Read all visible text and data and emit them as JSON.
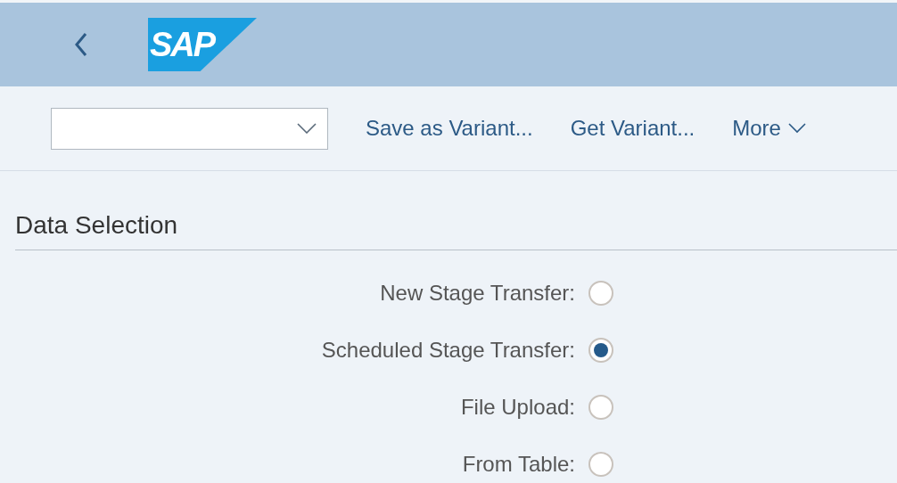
{
  "header": {
    "logo": "SAP"
  },
  "toolbar": {
    "actions": [
      "Save as Variant...",
      "Get Variant...",
      "More"
    ]
  },
  "section": {
    "title": "Data Selection",
    "options": [
      {
        "label": "New Stage Transfer:",
        "selected": false
      },
      {
        "label": "Scheduled Stage Transfer:",
        "selected": true
      },
      {
        "label": "File Upload:",
        "selected": false
      },
      {
        "label": "From Table:",
        "selected": false
      }
    ]
  }
}
